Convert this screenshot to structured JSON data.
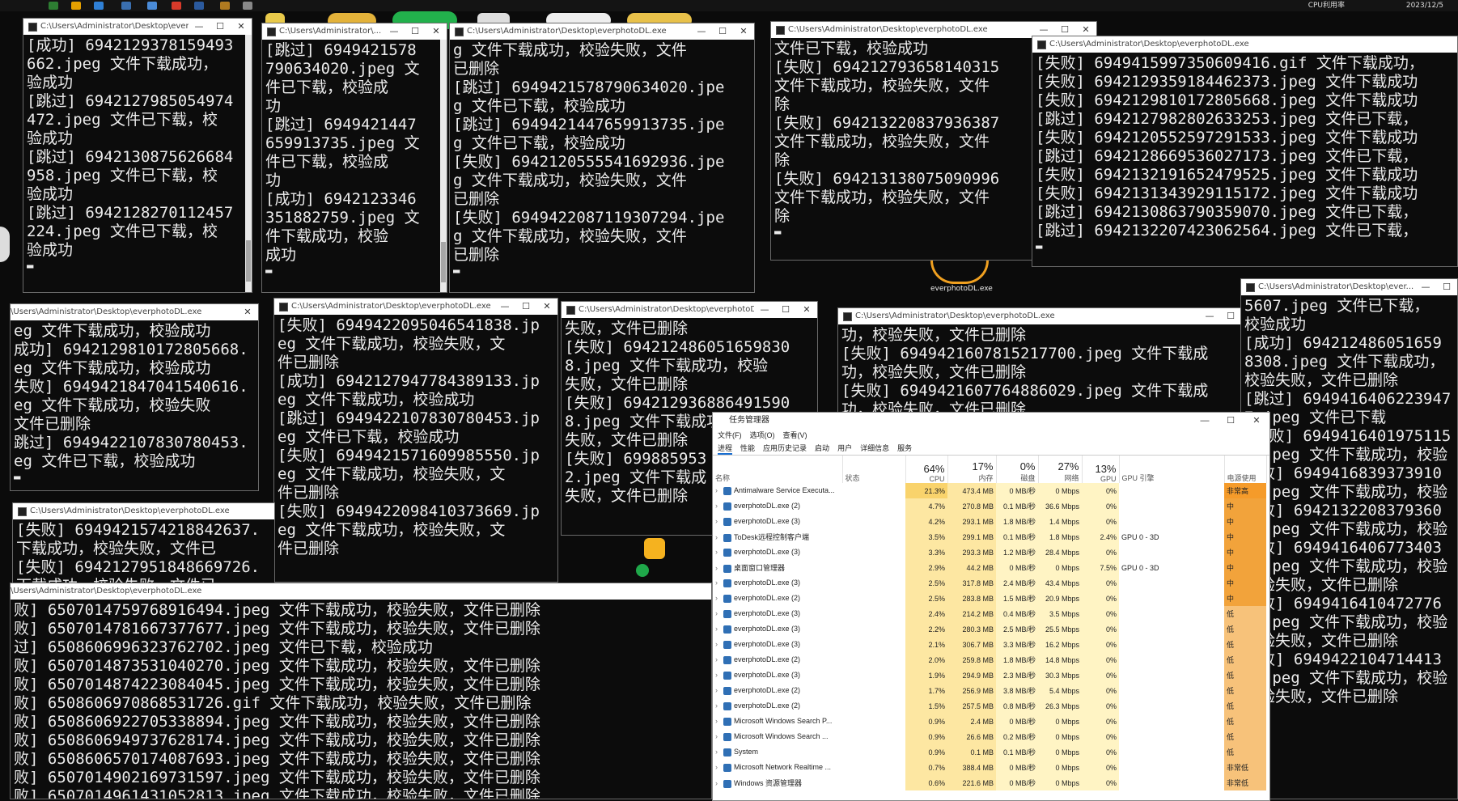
{
  "taskbar": {
    "clock": "2023/12/5",
    "tray": "CPU利用率"
  },
  "desktop": {
    "icon_label": "everphotoDL.exe"
  },
  "windows": {
    "w1": {
      "title": "C:\\Users\\Administrator\\Desktop\\everph...",
      "lines": [
        "[成功] 6942129378159493",
        "662.jpeg 文件下载成功，",
        "验成功",
        "[跳过] 6942127985054974",
        "472.jpeg 文件已下载，校",
        "验成功",
        "[跳过] 6942130875626684",
        "958.jpeg 文件已下载，校",
        "验成功",
        "[跳过] 6942128270112457",
        "224.jpeg 文件已下载，校",
        "验成功"
      ]
    },
    "w2": {
      "title": "C:\\Users\\Administrator\\...",
      "lines": [
        "[跳过] 6949421578",
        "790634020.jpeg 文",
        "件已下载，校验成",
        "功",
        "[跳过] 6949421447",
        "659913735.jpeg 文",
        "件已下载，校验成",
        "功",
        "[成功] 6942123346",
        "351882759.jpeg 文",
        "件下载成功，校验",
        "成功"
      ]
    },
    "w3": {
      "title": "C:\\Users\\Administrator\\Desktop\\everphotoDL.exe",
      "lines": [
        "g 文件下载成功，校验失败，文件",
        "已删除",
        "[跳过] 6949421578790634020.jpe",
        "g 文件已下载，校验成功",
        "[跳过] 6949421447659913735.jpe",
        "g 文件已下载，校验成功",
        "[失败] 6942120555541692936.jpe",
        "g 文件下载成功，校验失败，文件",
        "已删除",
        "[失败] 6949422087119307294.jpe",
        "g 文件下载成功，校验失败，文件",
        "已删除"
      ]
    },
    "w4": {
      "title": "C:\\Users\\Administrator\\Desktop\\everphotoDL.exe",
      "lines": [
        "文件已下载，校验成功",
        "[失败] 694212793658140315",
        "文件下载成功，校验失败，文件",
        "除",
        "[失败] 694213220837936387",
        "文件下载成功，校验失败，文件",
        "除",
        "[失败] 694213138075090996",
        "文件下载成功，校验失败，文件",
        "除"
      ]
    },
    "w5": {
      "title": "C:\\Users\\Administrator\\Desktop\\everphotoDL.exe",
      "lines": [
        "[失败] 6949415997350609416.gif 文件下载成功，",
        "[失败] 6942129359184462373.jpeg 文件下载成功",
        "[失败] 6942129810172805668.jpeg 文件下载成功",
        "[跳过] 6942127982802633253.jpeg 文件已下载，",
        "[失败] 6942120552597291533.jpeg 文件下载成功",
        "[跳过] 6942128669536027173.jpeg 文件已下载，",
        "[失败] 6942132191652479525.jpeg 文件下载成功",
        "[失败] 6942131343929115172.jpeg 文件下载成功",
        "[跳过] 6942130863790359070.jpeg 文件已下载，",
        "[跳过] 6942132207423062564.jpeg 文件已下载，"
      ]
    },
    "w6": {
      "title": "\\Users\\Administrator\\Desktop\\everphotoDL.exe",
      "lines": [
        "eg 文件下载成功，校验成功",
        "成功] 6942129810172805668.",
        "eg 文件下载成功，校验成功",
        "失败] 6949421847041540616.",
        "eg 文件下载成功，校验失败",
        "文件已删除",
        "跳过] 6949422107830780453.",
        "eg 文件已下载，校验成功"
      ]
    },
    "w7": {
      "title": "C:\\Users\\Administrator\\Desktop\\everphotoDL.exe",
      "lines": [
        "[失败] 6949422095046541838.jp",
        "eg 文件下载成功，校验失败，文",
        "件已删除",
        "[成功] 6942127947784389133.jp",
        "eg 文件下载成功，校验成功",
        "[跳过] 6949422107830780453.jp",
        "eg 文件已下载，校验成功",
        "[失败] 6949421571609985550.jp",
        "eg 文件下载成功，校验失败，文",
        "件已删除",
        "[失败] 6949422098410373669.jp",
        "eg 文件下载成功，校验失败，文",
        "件已删除"
      ]
    },
    "w8": {
      "title": "C:\\Users\\Administrator\\Desktop\\everphotoDL...",
      "lines": [
        "失败，文件已删除",
        "[失败] 694212486051659830",
        "8.jpeg 文件下载成功，校验",
        "失败，文件已删除",
        "[失败] 694212936886491590",
        "8.jpeg 文件下载成功，校验",
        "失败，文件已删除",
        "[失败] 699885953",
        "2.jpeg 文件下载成",
        "失败，文件已删除"
      ]
    },
    "w9": {
      "title": "C:\\Users\\Administrator\\Desktop\\everphotoDL.exe",
      "lines": [
        "功，校验失败，文件已删除",
        "[失败] 6949421607815217700.jpeg 文件下载成",
        "功，校验失败，文件已删除",
        "[失败] 6949421607764886029.jpeg 文件下载成",
        "功，校验失败，文件已删除"
      ]
    },
    "w10": {
      "title": "C:\\Users\\Administrator\\Desktop\\ever...",
      "lines": [
        "5607.jpeg 文件已下载，",
        "校验成功",
        "[成功] 694212486051659",
        "8308.jpeg 文件下载成功，",
        "校验失败，文件已删除",
        "[跳过] 6949416406223947",
        "7.jpeg 文件已下载",
        "[失败] 6949416401975115",
        "5.jpeg 文件下载成功，校验",
        "失败] 6949416839373910",
        "0.jpeg 文件下载成功，校验",
        "失败] 6942132208379360",
        "0.jpeg 文件下载成功，校验",
        "失败] 6949416406773403",
        "5.jpeg 文件下载成功，校验",
        "校验失败，文件已删除",
        "失败] 6949416410472776",
        "6.jpeg 文件下载成功，校验",
        "校验失败，文件已删除",
        "失败] 6949422104714413",
        "5.jpeg 文件下载成功，校验",
        "校验失败，文件已删除"
      ]
    },
    "w11": {
      "title": "C:\\Users\\Administrator\\Desktop\\everphotoDL.exe",
      "lines": [
        "[失败] 6949421574218842637.",
        "下载成功，校验失败，文件已",
        "[失败] 6942127951848669726.",
        "下载成功，校验失败，文件已"
      ]
    },
    "w12": {
      "title": "\\Users\\Administrator\\Desktop\\everphotoDL.exe",
      "lines": [
        "败] 6507014759768916494.jpeg 文件下载成功，校验失败，文件已删除",
        "败] 6507014781667377677.jpeg 文件下载成功，校验失败，文件已删除",
        "过] 6508606996323762702.jpeg 文件已下载，校验成功",
        "败] 6507014873531040270.jpeg 文件下载成功，校验失败，文件已删除",
        "败] 6507014874223084045.jpeg 文件下载成功，校验失败，文件已删除",
        "败] 6508606970868531726.gif 文件下载成功，校验失败，文件已删除",
        "败] 6508606922705338894.jpeg 文件下载成功，校验失败，文件已删除",
        "败] 6508606949737628174.jpeg 文件下载成功，校验失败，文件已删除",
        "败] 6508606570174087693.jpeg 文件下载成功，校验失败，文件已删除",
        "败] 6507014902169731597.jpeg 文件下载成功，校验失败，文件已删除",
        "败] 6507014961431052813.jpeg 文件下载成功，校验失败，文件已删除"
      ]
    }
  },
  "taskmgr": {
    "title": "任务管理器",
    "menu": [
      "文件(F)",
      "选项(O)",
      "查看(V)"
    ],
    "tabs": [
      "进程",
      "性能",
      "应用历史记录",
      "启动",
      "用户",
      "详细信息",
      "服务"
    ],
    "headers": {
      "name": "名称",
      "status": "状态",
      "cpu_pct": "64%",
      "cpu": "CPU",
      "mem_pct": "17%",
      "mem": "内存",
      "disk_pct": "0%",
      "disk": "磁盘",
      "net_pct": "27%",
      "net": "网络",
      "gpu_pct": "13%",
      "gpu": "GPU",
      "gpu_engine": "GPU 引擎",
      "power": "电源使用"
    },
    "rows": [
      {
        "name": "Antimalware Service Executa...",
        "cpu": "21.3%",
        "mem": "473.4 MB",
        "disk": "0 MB/秒",
        "net": "0 Mbps",
        "gpu": "0%",
        "engine": "",
        "power": "非常高"
      },
      {
        "name": "everphotoDL.exe (2)",
        "cpu": "4.7%",
        "mem": "270.8 MB",
        "disk": "0.1 MB/秒",
        "net": "36.6 Mbps",
        "gpu": "0%",
        "engine": "",
        "power": "中"
      },
      {
        "name": "everphotoDL.exe (3)",
        "cpu": "4.2%",
        "mem": "293.1 MB",
        "disk": "1.8 MB/秒",
        "net": "1.4 Mbps",
        "gpu": "0%",
        "engine": "",
        "power": "中"
      },
      {
        "name": "ToDesk远程控制客户端",
        "cpu": "3.5%",
        "mem": "299.1 MB",
        "disk": "0.1 MB/秒",
        "net": "1.8 Mbps",
        "gpu": "2.4%",
        "engine": "GPU 0 - 3D",
        "power": "中"
      },
      {
        "name": "everphotoDL.exe (3)",
        "cpu": "3.3%",
        "mem": "293.3 MB",
        "disk": "1.2 MB/秒",
        "net": "28.4 Mbps",
        "gpu": "0%",
        "engine": "",
        "power": "中"
      },
      {
        "name": "桌面窗口管理器",
        "cpu": "2.9%",
        "mem": "44.2 MB",
        "disk": "0 MB/秒",
        "net": "0 Mbps",
        "gpu": "7.5%",
        "engine": "GPU 0 - 3D",
        "power": "中"
      },
      {
        "name": "everphotoDL.exe (3)",
        "cpu": "2.5%",
        "mem": "317.8 MB",
        "disk": "2.4 MB/秒",
        "net": "43.4 Mbps",
        "gpu": "0%",
        "engine": "",
        "power": "中"
      },
      {
        "name": "everphotoDL.exe (2)",
        "cpu": "2.5%",
        "mem": "283.8 MB",
        "disk": "1.5 MB/秒",
        "net": "20.9 Mbps",
        "gpu": "0%",
        "engine": "",
        "power": "中"
      },
      {
        "name": "everphotoDL.exe (3)",
        "cpu": "2.4%",
        "mem": "214.2 MB",
        "disk": "0.4 MB/秒",
        "net": "3.5 Mbps",
        "gpu": "0%",
        "engine": "",
        "power": "低"
      },
      {
        "name": "everphotoDL.exe (3)",
        "cpu": "2.2%",
        "mem": "280.3 MB",
        "disk": "2.5 MB/秒",
        "net": "25.5 Mbps",
        "gpu": "0%",
        "engine": "",
        "power": "低"
      },
      {
        "name": "everphotoDL.exe (3)",
        "cpu": "2.1%",
        "mem": "306.7 MB",
        "disk": "3.3 MB/秒",
        "net": "16.2 Mbps",
        "gpu": "0%",
        "engine": "",
        "power": "低"
      },
      {
        "name": "everphotoDL.exe (2)",
        "cpu": "2.0%",
        "mem": "259.8 MB",
        "disk": "1.8 MB/秒",
        "net": "14.8 Mbps",
        "gpu": "0%",
        "engine": "",
        "power": "低"
      },
      {
        "name": "everphotoDL.exe (3)",
        "cpu": "1.9%",
        "mem": "294.9 MB",
        "disk": "2.3 MB/秒",
        "net": "30.3 Mbps",
        "gpu": "0%",
        "engine": "",
        "power": "低"
      },
      {
        "name": "everphotoDL.exe (2)",
        "cpu": "1.7%",
        "mem": "256.9 MB",
        "disk": "3.8 MB/秒",
        "net": "5.4 Mbps",
        "gpu": "0%",
        "engine": "",
        "power": "低"
      },
      {
        "name": "everphotoDL.exe (2)",
        "cpu": "1.5%",
        "mem": "257.5 MB",
        "disk": "0.8 MB/秒",
        "net": "26.3 Mbps",
        "gpu": "0%",
        "engine": "",
        "power": "低"
      },
      {
        "name": "Microsoft Windows Search P...",
        "cpu": "0.9%",
        "mem": "2.4 MB",
        "disk": "0 MB/秒",
        "net": "0 Mbps",
        "gpu": "0%",
        "engine": "",
        "power": "低"
      },
      {
        "name": "Microsoft Windows Search ...",
        "cpu": "0.9%",
        "mem": "26.6 MB",
        "disk": "0.2 MB/秒",
        "net": "0 Mbps",
        "gpu": "0%",
        "engine": "",
        "power": "低"
      },
      {
        "name": "System",
        "cpu": "0.9%",
        "mem": "0.1 MB",
        "disk": "0.1 MB/秒",
        "net": "0 Mbps",
        "gpu": "0%",
        "engine": "",
        "power": "低"
      },
      {
        "name": "Microsoft Network Realtime ...",
        "cpu": "0.7%",
        "mem": "388.4 MB",
        "disk": "0 MB/秒",
        "net": "0 Mbps",
        "gpu": "0%",
        "engine": "",
        "power": "非常低"
      },
      {
        "name": "Windows 资源管理器",
        "cpu": "0.6%",
        "mem": "221.6 MB",
        "disk": "0 MB/秒",
        "net": "0 Mbps",
        "gpu": "0%",
        "engine": "",
        "power": "非常低"
      }
    ]
  },
  "colors": {
    "console_bg": "#0c0c0c",
    "console_text": "#ececec",
    "accent": "#1a6fd1",
    "power_high": "#f59b2a"
  }
}
